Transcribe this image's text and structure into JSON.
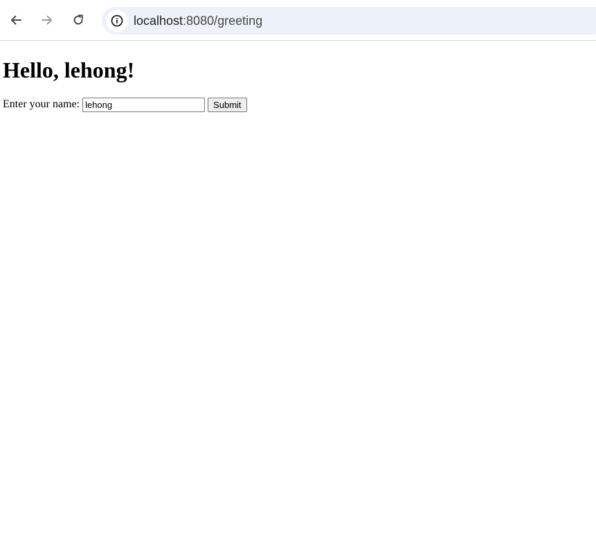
{
  "browser": {
    "icons": {
      "back": "back-arrow-icon",
      "forward": "forward-arrow-icon",
      "reload": "reload-icon",
      "site_info": "info-icon"
    },
    "url": {
      "host": "localhost",
      "path": ":8080/greeting"
    }
  },
  "page": {
    "heading": "Hello, lehong!",
    "form": {
      "label": "Enter your name:",
      "input_value": "lehong",
      "submit_label": "Submit"
    }
  }
}
